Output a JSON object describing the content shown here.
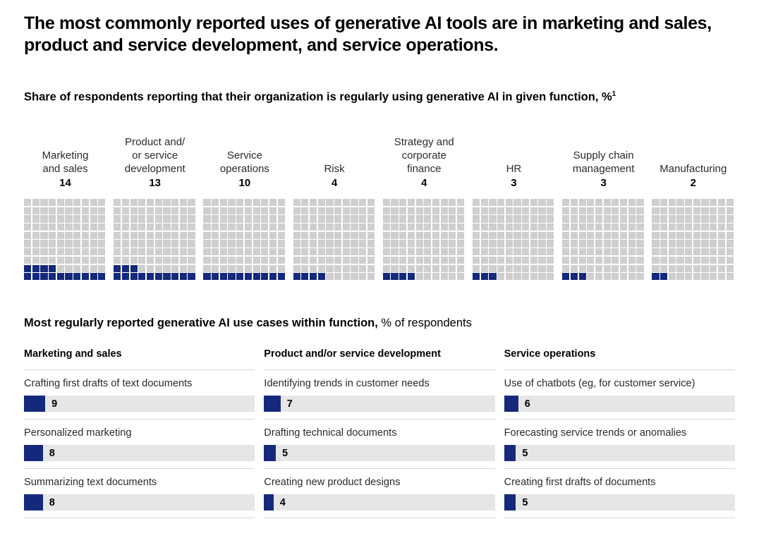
{
  "title": "The most commonly reported uses of generative AI tools are in marketing and sales, product and service development, and service operations.",
  "subtitle": {
    "text": "Share of respondents reporting that their organization is regularly using generative AI in given function, %",
    "footnote_marker": "1"
  },
  "section_heading": {
    "bold": "Most regularly reported generative AI use cases within function,",
    "normal": " % of respondents"
  },
  "colors": {
    "accent": "#15297c",
    "waffle_empty": "#cfcfcf",
    "bar_track": "#e6e6e6",
    "rule": "#d6d6d6"
  },
  "chart_data": [
    {
      "type": "waffle",
      "title": "Share of respondents reporting that their organization is regularly using generative AI in given function, %",
      "total_cells": 100,
      "grid": "10x10",
      "fill_order": "bottom-left-to-right",
      "categories": [
        "Marketing and sales",
        "Product and/or service development",
        "Service operations",
        "Risk",
        "Strategy and corporate finance",
        "HR",
        "Supply chain management",
        "Manufacturing"
      ],
      "values": [
        14,
        13,
        10,
        4,
        4,
        3,
        3,
        2
      ],
      "labels_wrapped": [
        "Marketing\nand sales",
        "Product and/\nor service\ndevelopment",
        "Service\noperations",
        "Risk",
        "Strategy and\ncorporate\nfinance",
        "HR",
        "Supply chain\nmanagement",
        "Manufacturing"
      ],
      "xlabel": "",
      "ylabel": "",
      "legend": []
    },
    {
      "type": "bar",
      "title": "Most regularly reported generative AI use cases within function, % of respondents",
      "xlabel": "% of respondents",
      "ylabel": "",
      "xlim": [
        0,
        100
      ],
      "grid": false,
      "groups": [
        {
          "name": "Marketing and sales",
          "categories": [
            "Crafting first drafts of text documents",
            "Personalized marketing",
            "Summarizing text documents"
          ],
          "values": [
            9,
            8,
            8
          ]
        },
        {
          "name": "Product and/or service development",
          "categories": [
            "Identifying trends in customer needs",
            "Drafting technical documents",
            "Creating new product designs"
          ],
          "values": [
            7,
            5,
            4
          ]
        },
        {
          "name": "Service operations",
          "categories": [
            "Use of chatbots (eg, for customer service)",
            "Forecasting service trends or anomalies",
            "Creating first drafts of documents"
          ],
          "values": [
            6,
            5,
            5
          ]
        }
      ]
    }
  ]
}
